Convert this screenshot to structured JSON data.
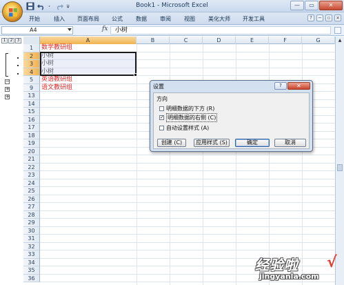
{
  "window": {
    "title": "Book1 - Microsoft Excel",
    "minimize": "—",
    "restore": "▭",
    "close": "✕"
  },
  "ribbon": {
    "tabs": [
      "开始",
      "插入",
      "页面布局",
      "公式",
      "数据",
      "审阅",
      "视图",
      "美化大师",
      "开发工具"
    ]
  },
  "formula_bar": {
    "name_box": "A4",
    "fx": "fx",
    "content": "小树"
  },
  "outline": {
    "levels": [
      "1",
      "2",
      "3"
    ],
    "collapse_symbol": "−",
    "expand_symbol": "+"
  },
  "sheet": {
    "columns": [
      "A",
      "B",
      "C",
      "D",
      "E",
      "F",
      "G"
    ],
    "selected_column": "A",
    "rows": [
      {
        "n": "1",
        "a": "数学教研组",
        "red": true
      },
      {
        "n": "2",
        "a": "小树",
        "red": false
      },
      {
        "n": "3",
        "a": "小树",
        "red": false
      },
      {
        "n": "4",
        "a": "小树",
        "red": false
      },
      {
        "n": "5",
        "a": "英语教研组",
        "red": true
      },
      {
        "n": "9",
        "a": "语文教研组",
        "red": true
      },
      {
        "n": "13",
        "a": ""
      },
      {
        "n": "14",
        "a": ""
      },
      {
        "n": "15",
        "a": ""
      },
      {
        "n": "16",
        "a": ""
      },
      {
        "n": "17",
        "a": ""
      },
      {
        "n": "18",
        "a": ""
      },
      {
        "n": "19",
        "a": ""
      },
      {
        "n": "20",
        "a": ""
      },
      {
        "n": "21",
        "a": ""
      },
      {
        "n": "22",
        "a": ""
      },
      {
        "n": "23",
        "a": ""
      },
      {
        "n": "24",
        "a": ""
      },
      {
        "n": "25",
        "a": ""
      },
      {
        "n": "26",
        "a": ""
      },
      {
        "n": "27",
        "a": ""
      },
      {
        "n": "28",
        "a": ""
      },
      {
        "n": "29",
        "a": ""
      },
      {
        "n": "30",
        "a": ""
      },
      {
        "n": "31",
        "a": ""
      },
      {
        "n": "32",
        "a": ""
      },
      {
        "n": "33",
        "a": ""
      },
      {
        "n": "34",
        "a": ""
      },
      {
        "n": "35",
        "a": ""
      },
      {
        "n": "36",
        "a": ""
      }
    ],
    "red_color": "#e02a2a"
  },
  "dialog": {
    "title": "设置",
    "help": "?",
    "close": "✕",
    "group_label": "方向",
    "options": [
      {
        "label": "明细数据的下方 (R)",
        "checked": false
      },
      {
        "label": "明细数据的右侧 (C)",
        "checked": true
      },
      {
        "label": "自动设置样式 (A)",
        "checked": false
      }
    ],
    "buttons": {
      "create": "创建 (C)",
      "apply_styles": "应用样式 (S)",
      "ok": "确定",
      "cancel": "取消"
    }
  },
  "watermark": {
    "text": "经验啦",
    "check": "√",
    "url": "jingyanla.com"
  }
}
